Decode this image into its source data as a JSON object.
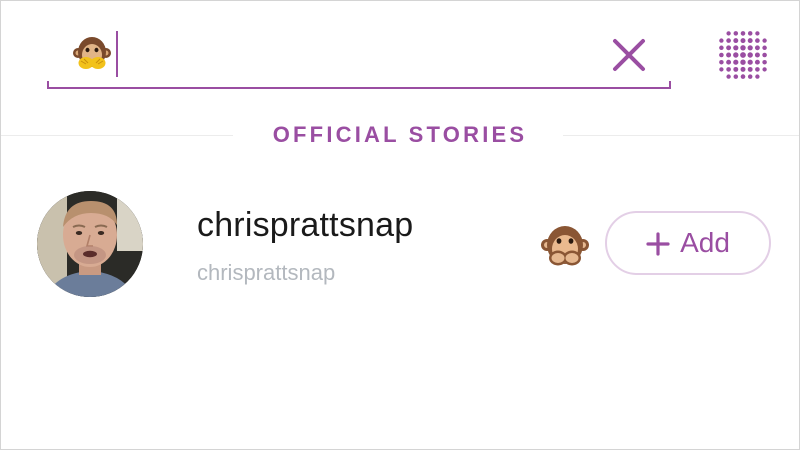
{
  "search": {
    "value": "",
    "emoji": "monkey-covering-mouth",
    "clear_icon": "close-icon"
  },
  "top_right": {
    "icon": "dots-grid-icon"
  },
  "section": {
    "title": "OFFICIAL STORIES"
  },
  "results": [
    {
      "display_name": "chrisprattsnap",
      "username": "chrisprattsnap",
      "badge_emoji": "monkey-covering-mouth",
      "action_label": "Add"
    }
  ],
  "colors": {
    "accent": "#9a4ea2",
    "add_border": "#e3cfe6",
    "username_gray": "#b3b8be",
    "divider": "#ececec"
  }
}
